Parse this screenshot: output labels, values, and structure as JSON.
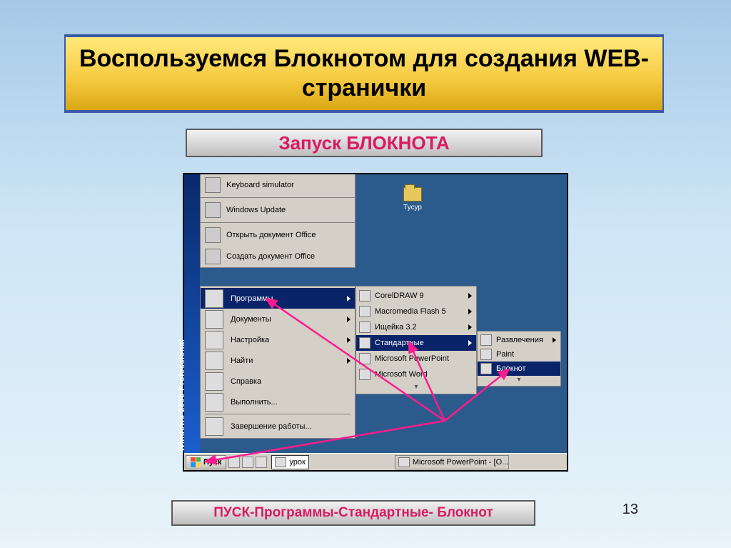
{
  "title": "Воспользуемся Блокнотом для создания WEB-странички",
  "subtitle": "Запуск  БЛОКНОТА",
  "footer_path": "ПУСК-Программы-Стандартные- Блокнот",
  "slide_number": "13",
  "desktop": {
    "folder_label": "Тусур"
  },
  "sidebar_text": "Windows 2000 Professional",
  "start_top": [
    "Keyboard simulator",
    "Windows Update",
    "Открыть документ Office",
    "Создать документ Office"
  ],
  "start_main": {
    "programs": "Программы",
    "documents": "Документы",
    "settings": "Настройка",
    "find": "Найти",
    "help": "Справка",
    "run": "Выполнить...",
    "shutdown": "Завершение работы..."
  },
  "programs_submenu": {
    "items": [
      "CorelDRAW 9",
      "Macromedia Flash 5",
      "Ищейка 3.2",
      "Стандартные",
      "Microsoft PowerPoint",
      "Microsoft Word"
    ],
    "selected_index": 3
  },
  "standard_submenu": {
    "items": [
      "Развлечения",
      "Paint",
      "Блокнот"
    ],
    "selected_index": 2
  },
  "taskbar": {
    "start": "Пуск",
    "task_folder": "урок",
    "task_ppt": "Microsoft PowerPoint - [O..."
  }
}
